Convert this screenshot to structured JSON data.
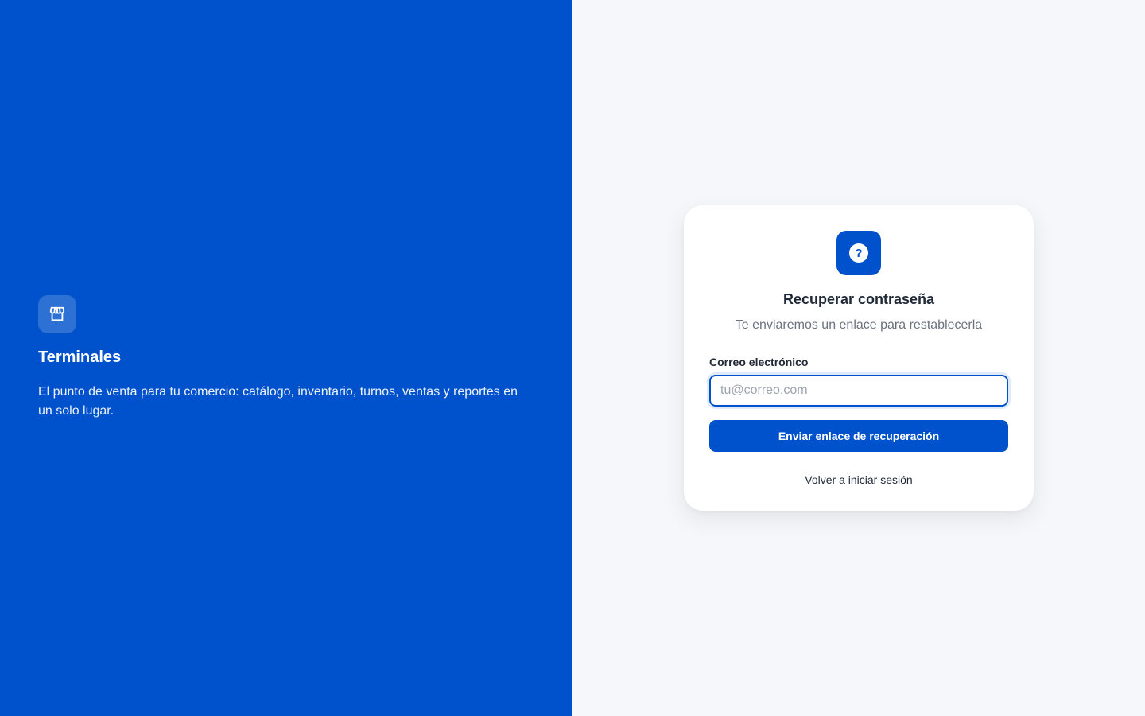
{
  "brand": {
    "icon": "store-icon",
    "title": "Terminales",
    "description": "El punto de venta para tu comercio: catálogo, inventario, turnos, ventas y reportes en un solo lugar."
  },
  "card": {
    "icon": "question-icon",
    "title": "Recuperar contraseña",
    "subtitle": "Te enviaremos un enlace para restablecerla",
    "email": {
      "label": "Correo electrónico",
      "value": "",
      "placeholder": "tu@correo.com"
    },
    "submit_label": "Enviar enlace de recuperación",
    "back_link_label": "Volver a iniciar sesión"
  },
  "colors": {
    "primary": "#0052cc",
    "background": "#f5f7fa",
    "text": "#1f2937",
    "muted": "#6b7280"
  }
}
